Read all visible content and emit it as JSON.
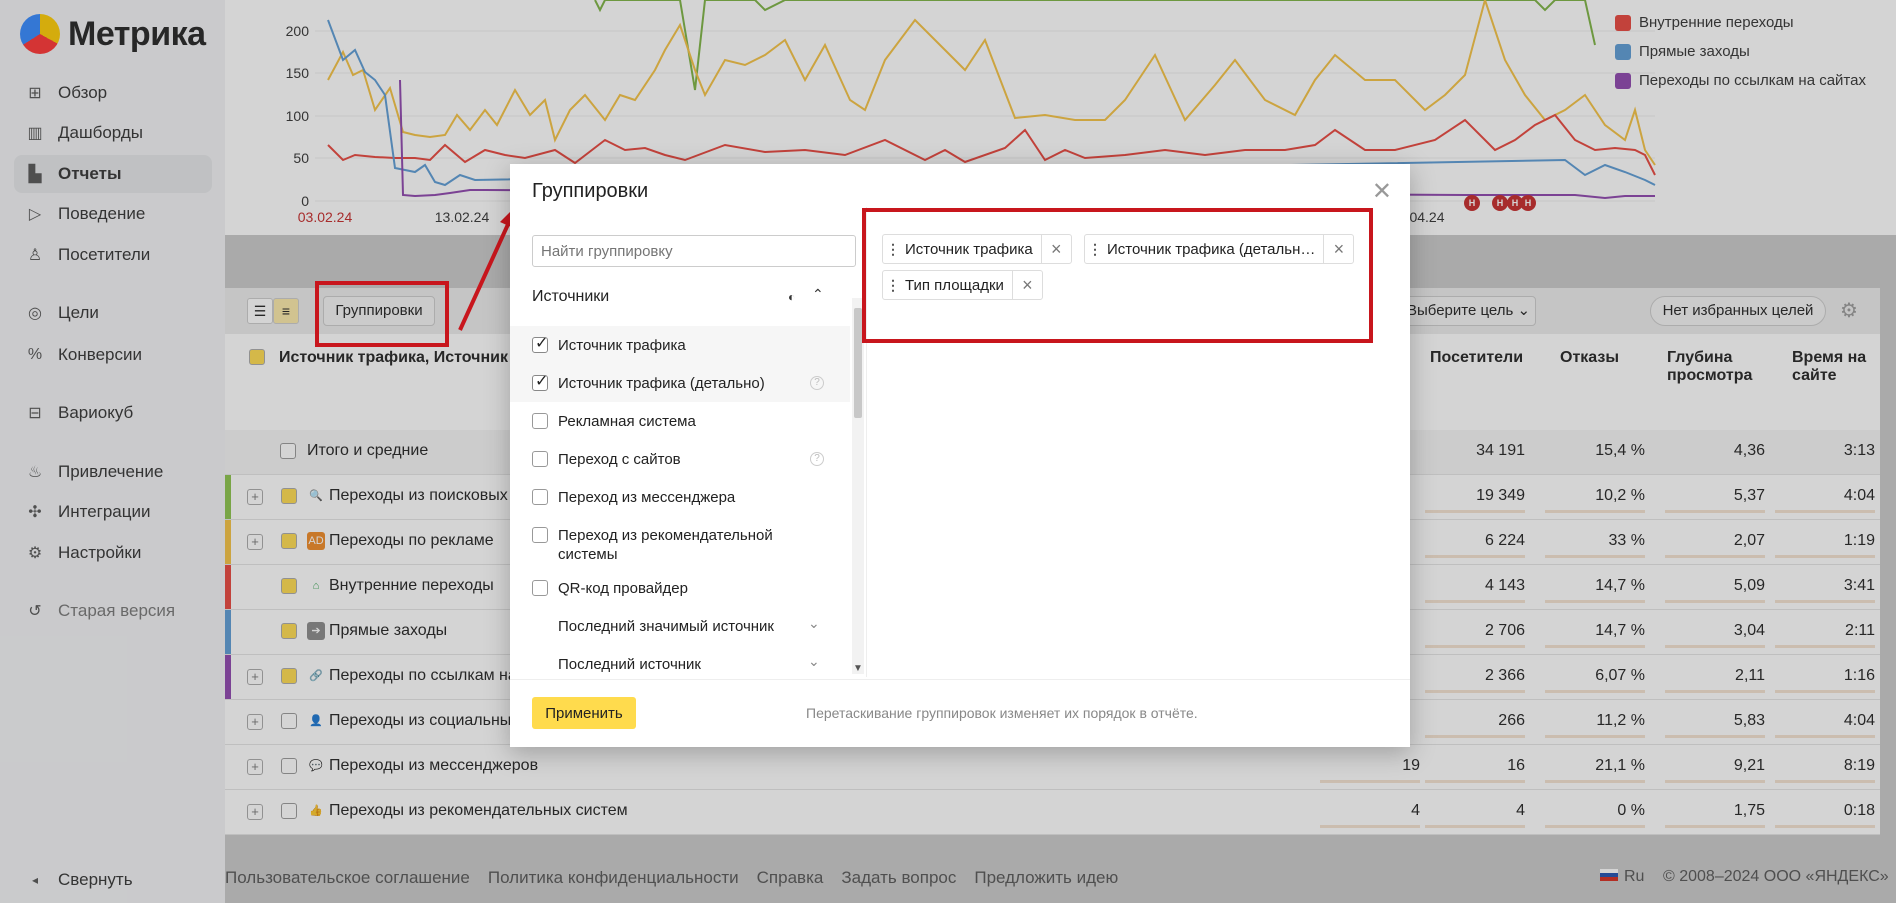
{
  "app": {
    "logo_text": "Метрика"
  },
  "sidebar": {
    "items": [
      {
        "label": "Обзор",
        "icon": "grid-icon"
      },
      {
        "label": "Дашборды",
        "icon": "dashboard-icon"
      },
      {
        "label": "Отчеты",
        "icon": "bar-chart-icon",
        "active": true
      },
      {
        "label": "Поведение",
        "icon": "play-icon"
      },
      {
        "label": "Посетители",
        "icon": "user-icon"
      },
      {
        "label": "Цели",
        "icon": "target-icon"
      },
      {
        "label": "Конверсии",
        "icon": "percent-icon"
      },
      {
        "label": "Вариокуб",
        "icon": "cube-icon"
      },
      {
        "label": "Привлечение",
        "icon": "flame-icon"
      },
      {
        "label": "Интеграции",
        "icon": "puzzle-icon"
      },
      {
        "label": "Настройки",
        "icon": "gear-icon"
      },
      {
        "label": "Старая версия",
        "icon": "history-icon"
      }
    ],
    "collapse_label": "Свернуть"
  },
  "chart": {
    "y_ticks": [
      "200",
      "150",
      "100",
      "50",
      "0"
    ],
    "x_ticks": [
      "03.02.24",
      "13.02.24",
      "04.24"
    ],
    "legend": [
      {
        "label": "Внутренние переходы",
        "color": "#e8453c"
      },
      {
        "label": "Прямые заходы",
        "color": "#5b9bd5"
      },
      {
        "label": "Переходы по ссылкам на сайтах",
        "color": "#8e44ad"
      }
    ],
    "marker_label": "Н"
  },
  "toolbar": {
    "groupings_button": "Группировки",
    "goal_select": "Выберите цель",
    "favorites_button": "Нет избранных целей"
  },
  "table": {
    "header_first": "Источник трафика, Источник тра",
    "headers": [
      "Посетители",
      "Отказы",
      "Глубина просмотра",
      "Время на сайте"
    ],
    "totals": {
      "label": "Итого и средние",
      "values": [
        "34 191",
        "15,4 %",
        "4,36",
        "3:13"
      ]
    },
    "rows": [
      {
        "label": "Переходы из поисковых си",
        "color": "#8bc34a",
        "checked": true,
        "icon": "search-icon",
        "values": [
          "",
          "19 349",
          "10,2 %",
          "5,37",
          "4:04"
        ]
      },
      {
        "label": "Переходы по рекламе",
        "color": "#f5c242",
        "checked": true,
        "icon": "ad-icon",
        "values": [
          "",
          "6 224",
          "33 %",
          "2,07",
          "1:19"
        ]
      },
      {
        "label": "Внутренние переходы",
        "color": "#e8453c",
        "checked": true,
        "icon": "home-icon",
        "values": [
          "",
          "4 143",
          "14,7 %",
          "5,09",
          "3:41"
        ]
      },
      {
        "label": "Прямые заходы",
        "color": "#5b9bd5",
        "checked": true,
        "icon": "arrow-icon",
        "values": [
          "",
          "2 706",
          "14,7 %",
          "3,04",
          "2:11"
        ]
      },
      {
        "label": "Переходы по ссылкам на с",
        "color": "#8e44ad",
        "checked": true,
        "icon": "link-icon",
        "values": [
          "",
          "2 366",
          "6,07 %",
          "2,11",
          "1:16"
        ]
      },
      {
        "label": "Переходы из социальных с",
        "color": "",
        "checked": false,
        "icon": "social-icon",
        "values": [
          "",
          "266",
          "11,2 %",
          "5,83",
          "4:04"
        ]
      },
      {
        "label": "Переходы из мессенджеров",
        "color": "",
        "checked": false,
        "icon": "chat-icon",
        "values": [
          "19",
          "16",
          "21,1 %",
          "9,21",
          "8:19"
        ]
      },
      {
        "label": "Переходы из рекомендательных систем",
        "color": "",
        "checked": false,
        "icon": "thumb-icon",
        "values": [
          "4",
          "4",
          "0 %",
          "1,75",
          "0:18"
        ]
      }
    ]
  },
  "modal": {
    "title": "Группировки",
    "search_placeholder": "Найти группировку",
    "section": "Источники",
    "options": [
      {
        "label": "Источник трафика",
        "checked": true,
        "help": false
      },
      {
        "label": "Источник трафика (детально)",
        "checked": true,
        "help": true
      },
      {
        "label": "Рекламная система",
        "checked": false,
        "help": false
      },
      {
        "label": "Переход с сайтов",
        "checked": false,
        "help": true
      },
      {
        "label": "Переход из мессенджера",
        "checked": false,
        "help": false
      },
      {
        "label": "Переход из рекомендательной системы",
        "checked": false,
        "help": false
      },
      {
        "label": "QR-код провайдер",
        "checked": false,
        "help": false
      },
      {
        "label": "Последний значимый источник",
        "expandable": true
      },
      {
        "label": "Последний источник",
        "expandable": true
      }
    ],
    "chips": [
      "Источник трафика",
      "Источник трафика (детальн…",
      "Тип площадки"
    ],
    "apply_button": "Применить",
    "footer_note": "Перетаскивание группировок изменяет их порядок в отчёте."
  },
  "footer": {
    "links": [
      "Пользовательское соглашение",
      "Политика конфиденциальности",
      "Справка",
      "Задать вопрос",
      "Предложить идею"
    ],
    "lang": "Ru",
    "copyright": "© 2008–2024 ООО «ЯНДЕКС»"
  },
  "colors": {
    "accent_yellow": "#ffdb4d",
    "highlight_red": "#c8161d"
  }
}
